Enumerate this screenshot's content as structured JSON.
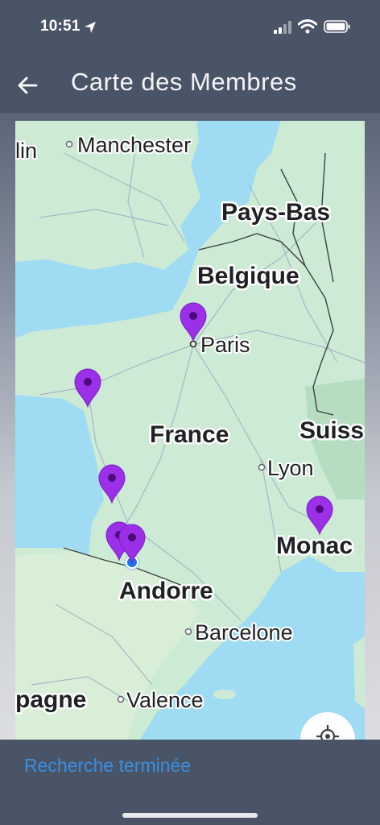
{
  "status_bar": {
    "time": "10:51"
  },
  "header": {
    "title": "Carte des Membres"
  },
  "map": {
    "labels": {
      "manchester": "Manchester",
      "lin": "lin",
      "pays_bas": "Pays-Bas",
      "belgique": "Belgique",
      "paris": "Paris",
      "france": "France",
      "suisse": "Suiss",
      "lyon": "Lyon",
      "monaco": "Monac",
      "andorre": "Andorre",
      "barcelone": "Barcelone",
      "espagne": "pagne",
      "valence": "Valence"
    },
    "marker_color": "#9b30e8",
    "water_color": "#9fdcf3",
    "land_color": "#cdebd4"
  },
  "footer": {
    "status_message": "Recherche terminée"
  }
}
